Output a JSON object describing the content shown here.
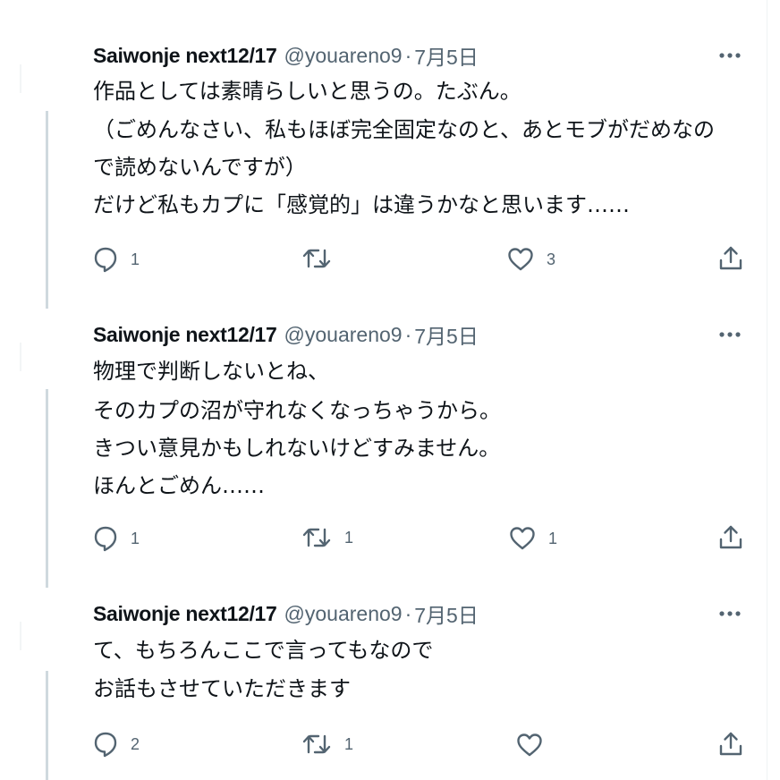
{
  "tweets": [
    {
      "author": "Saiwonje next12/17",
      "handle": "@youareno9",
      "separator": "·",
      "date": "7月5日",
      "lines": [
        "作品としては素晴らしいと思うの。たぶん。",
        "（ごめんなさい、私もほぼ完全固定なのと、あとモブがだめなの",
        "で読めないんですが）",
        "だけど私もカプに「感覚的」は違うかなと思います……"
      ],
      "replies": "1",
      "retweets": "",
      "likes": "3"
    },
    {
      "author": "Saiwonje next12/17",
      "handle": "@youareno9",
      "separator": "·",
      "date": "7月5日",
      "lines": [
        "物理で判断しないとね、",
        "そのカプの沼が守れなくなっちゃうから。",
        "きつい意見かもしれないけどすみません。",
        "ほんとごめん……"
      ],
      "replies": "1",
      "retweets": "1",
      "likes": "1"
    },
    {
      "author": "Saiwonje next12/17",
      "handle": "@youareno9",
      "separator": "·",
      "date": "7月5日",
      "lines": [
        "て、もちろんここで言ってもなので",
        "お話もさせていただきます"
      ],
      "replies": "2",
      "retweets": "1",
      "likes": ""
    }
  ],
  "icons": {
    "more": "more-horizontal-icon",
    "reply": "reply-bubble-icon",
    "retweet": "retweet-icon",
    "like": "heart-icon",
    "share": "share-upload-icon"
  },
  "colors": {
    "text": "#0f1419",
    "secondary": "#536471",
    "thread_line": "#cfd9de",
    "background": "#ffffff"
  }
}
